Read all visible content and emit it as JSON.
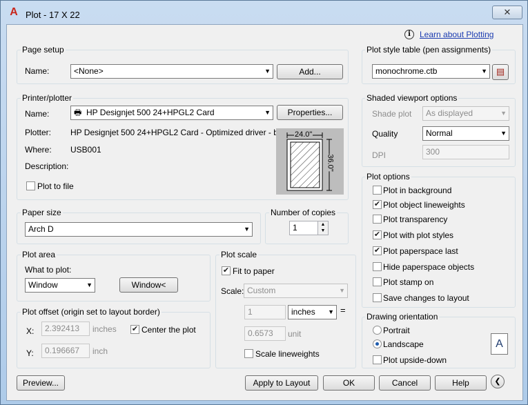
{
  "window": {
    "title": "Plot - 17 X 22",
    "close": "✕"
  },
  "help_link": "Learn about Plotting",
  "page_setup": {
    "title": "Page setup",
    "name_label": "Name:",
    "name_value": "<None>",
    "add_button": "Add..."
  },
  "printer": {
    "title": "Printer/plotter",
    "name_label": "Name:",
    "name_value": "HP Designjet 500 24+HPGL2 Card",
    "properties_button": "Properties...",
    "plotter_label": "Plotter:",
    "plotter_value": "HP Designjet 500 24+HPGL2 Card - Optimized driver - b...",
    "where_label": "Where:",
    "where_value": "USB001",
    "description_label": "Description:",
    "plot_to_file": "Plot to file",
    "preview_width": "24.0\"",
    "preview_height": "36.0\""
  },
  "paper_size": {
    "title": "Paper size",
    "value": "Arch D"
  },
  "copies": {
    "title": "Number of copies",
    "value": "1"
  },
  "plot_area": {
    "title": "Plot area",
    "what_label": "What to plot:",
    "what_value": "Window",
    "window_button": "Window<"
  },
  "plot_offset": {
    "title": "Plot offset (origin set to layout border)",
    "x_label": "X:",
    "x_value": "2.392413",
    "x_unit": "inches",
    "y_label": "Y:",
    "y_value": "0.196667",
    "y_unit": "inch",
    "center": "Center the plot"
  },
  "plot_scale": {
    "title": "Plot scale",
    "fit": "Fit to paper",
    "scale_label": "Scale:",
    "scale_value": "Custom",
    "num_value": "1",
    "num_unit": "inches",
    "equals": "=",
    "den_value": "0.6573",
    "den_unit": "unit",
    "lineweights": "Scale lineweights"
  },
  "plot_style": {
    "title": "Plot style table (pen assignments)",
    "value": "monochrome.ctb"
  },
  "shaded": {
    "title": "Shaded viewport options",
    "shade_label": "Shade plot",
    "shade_value": "As displayed",
    "quality_label": "Quality",
    "quality_value": "Normal",
    "dpi_label": "DPI",
    "dpi_value": "300"
  },
  "plot_options": {
    "title": "Plot options",
    "items": [
      {
        "label": "Plot in background",
        "checked": false
      },
      {
        "label": "Plot object lineweights",
        "checked": true
      },
      {
        "label": "Plot transparency",
        "checked": false
      },
      {
        "label": "Plot with plot styles",
        "checked": true
      },
      {
        "label": "Plot paperspace last",
        "checked": true
      },
      {
        "label": "Hide paperspace objects",
        "checked": false
      },
      {
        "label": "Plot stamp on",
        "checked": false
      },
      {
        "label": "Save changes to layout",
        "checked": false
      }
    ]
  },
  "orientation": {
    "title": "Drawing orientation",
    "portrait": "Portrait",
    "landscape": "Landscape",
    "selected": "Landscape",
    "upside_down": "Plot upside-down",
    "icon_letter": "A"
  },
  "buttons": {
    "preview": "Preview...",
    "apply": "Apply to Layout",
    "ok": "OK",
    "cancel": "Cancel",
    "help": "Help",
    "collapse": "❮"
  },
  "colors": {
    "accent": "#1e5bad",
    "link": "#1a3bb0"
  }
}
